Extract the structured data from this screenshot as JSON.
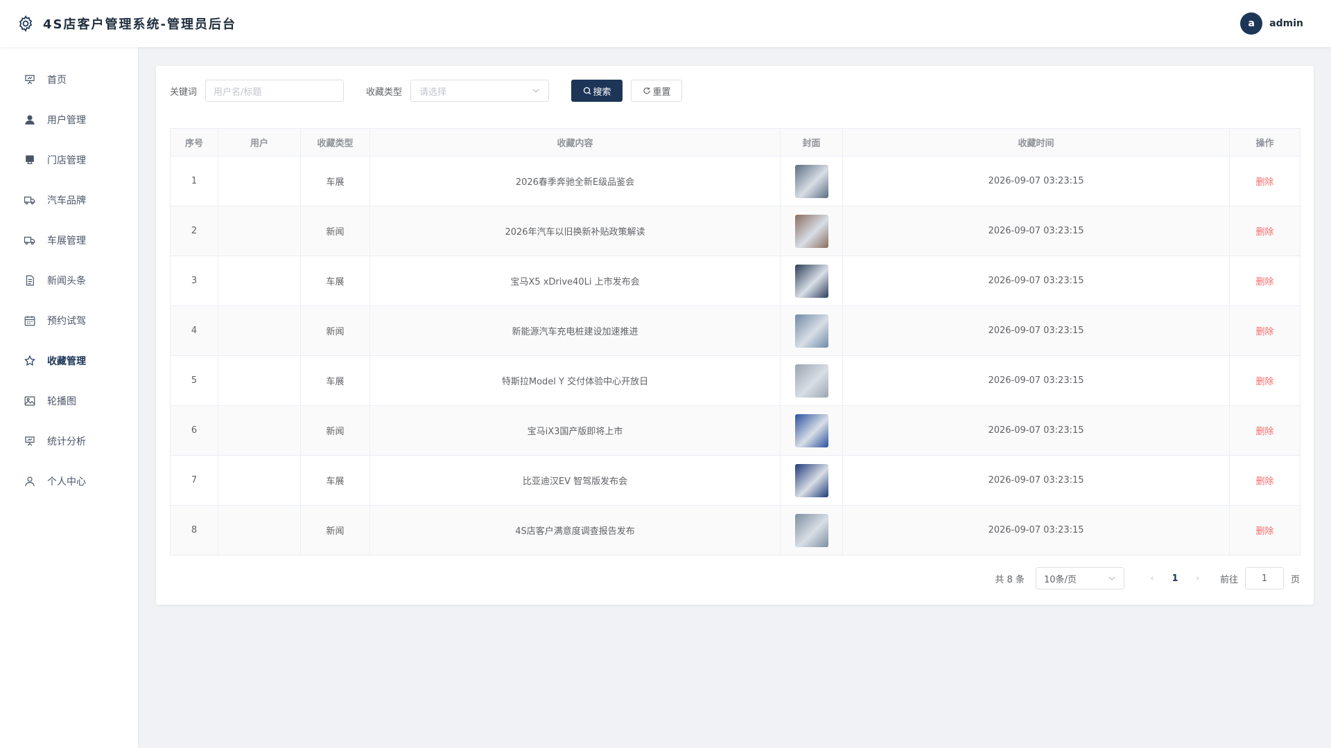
{
  "header": {
    "title": "4S店客户管理系统-管理员后台",
    "avatar_letter": "a",
    "username": "admin"
  },
  "sidebar": {
    "items": [
      {
        "label": "首页",
        "icon": "presentation-icon"
      },
      {
        "label": "用户管理",
        "icon": "user-icon"
      },
      {
        "label": "门店管理",
        "icon": "store-icon"
      },
      {
        "label": "汽车品牌",
        "icon": "truck-icon"
      },
      {
        "label": "车展管理",
        "icon": "truck-icon"
      },
      {
        "label": "新闻头条",
        "icon": "document-icon"
      },
      {
        "label": "预约试驾",
        "icon": "calendar-icon"
      },
      {
        "label": "收藏管理",
        "icon": "star-icon",
        "active": true
      },
      {
        "label": "轮播图",
        "icon": "image-icon"
      },
      {
        "label": "统计分析",
        "icon": "presentation-icon"
      },
      {
        "label": "个人中心",
        "icon": "user-outline-icon"
      }
    ]
  },
  "filters": {
    "keyword_label": "关键词",
    "keyword_placeholder": "用户名/标题",
    "type_label": "收藏类型",
    "type_placeholder": "请选择",
    "search_label": "搜索",
    "reset_label": "重置"
  },
  "table": {
    "columns": [
      "序号",
      "用户",
      "收藏类型",
      "收藏内容",
      "封面",
      "收藏时间",
      "操作"
    ],
    "action_label": "删除",
    "rows": [
      {
        "index": "1",
        "user": "",
        "type": "车展",
        "content": "2026春季奔驰全新E级品鉴会",
        "time": "2026-09-07 03:23:15",
        "thumb": "#5b6d82"
      },
      {
        "index": "2",
        "user": "",
        "type": "新闻",
        "content": "2026年汽车以旧换新补贴政策解读",
        "time": "2026-09-07 03:23:15",
        "thumb": "#8a6d5e"
      },
      {
        "index": "3",
        "user": "",
        "type": "车展",
        "content": "宝马X5 xDrive40Li 上市发布会",
        "time": "2026-09-07 03:23:15",
        "thumb": "#2c3e5a"
      },
      {
        "index": "4",
        "user": "",
        "type": "新闻",
        "content": "新能源汽车充电桩建设加速推进",
        "time": "2026-09-07 03:23:15",
        "thumb": "#6f8aa8"
      },
      {
        "index": "5",
        "user": "",
        "type": "车展",
        "content": "特斯拉Model Y 交付体验中心开放日",
        "time": "2026-09-07 03:23:15",
        "thumb": "#9aa5b1"
      },
      {
        "index": "6",
        "user": "",
        "type": "新闻",
        "content": "宝马iX3国产版即将上市",
        "time": "2026-09-07 03:23:15",
        "thumb": "#2a4f9e"
      },
      {
        "index": "7",
        "user": "",
        "type": "车展",
        "content": "比亚迪汉EV 智驾版发布会",
        "time": "2026-09-07 03:23:15",
        "thumb": "#1f3a7a"
      },
      {
        "index": "8",
        "user": "",
        "type": "新闻",
        "content": "4S店客户满意度调查报告发布",
        "time": "2026-09-07 03:23:15",
        "thumb": "#7e8fa0"
      }
    ]
  },
  "pagination": {
    "total": "共 8 条",
    "page_size": "10条/页",
    "current_page": "1",
    "goto_label": "前往",
    "goto_value": "1",
    "page_suffix": "页"
  }
}
